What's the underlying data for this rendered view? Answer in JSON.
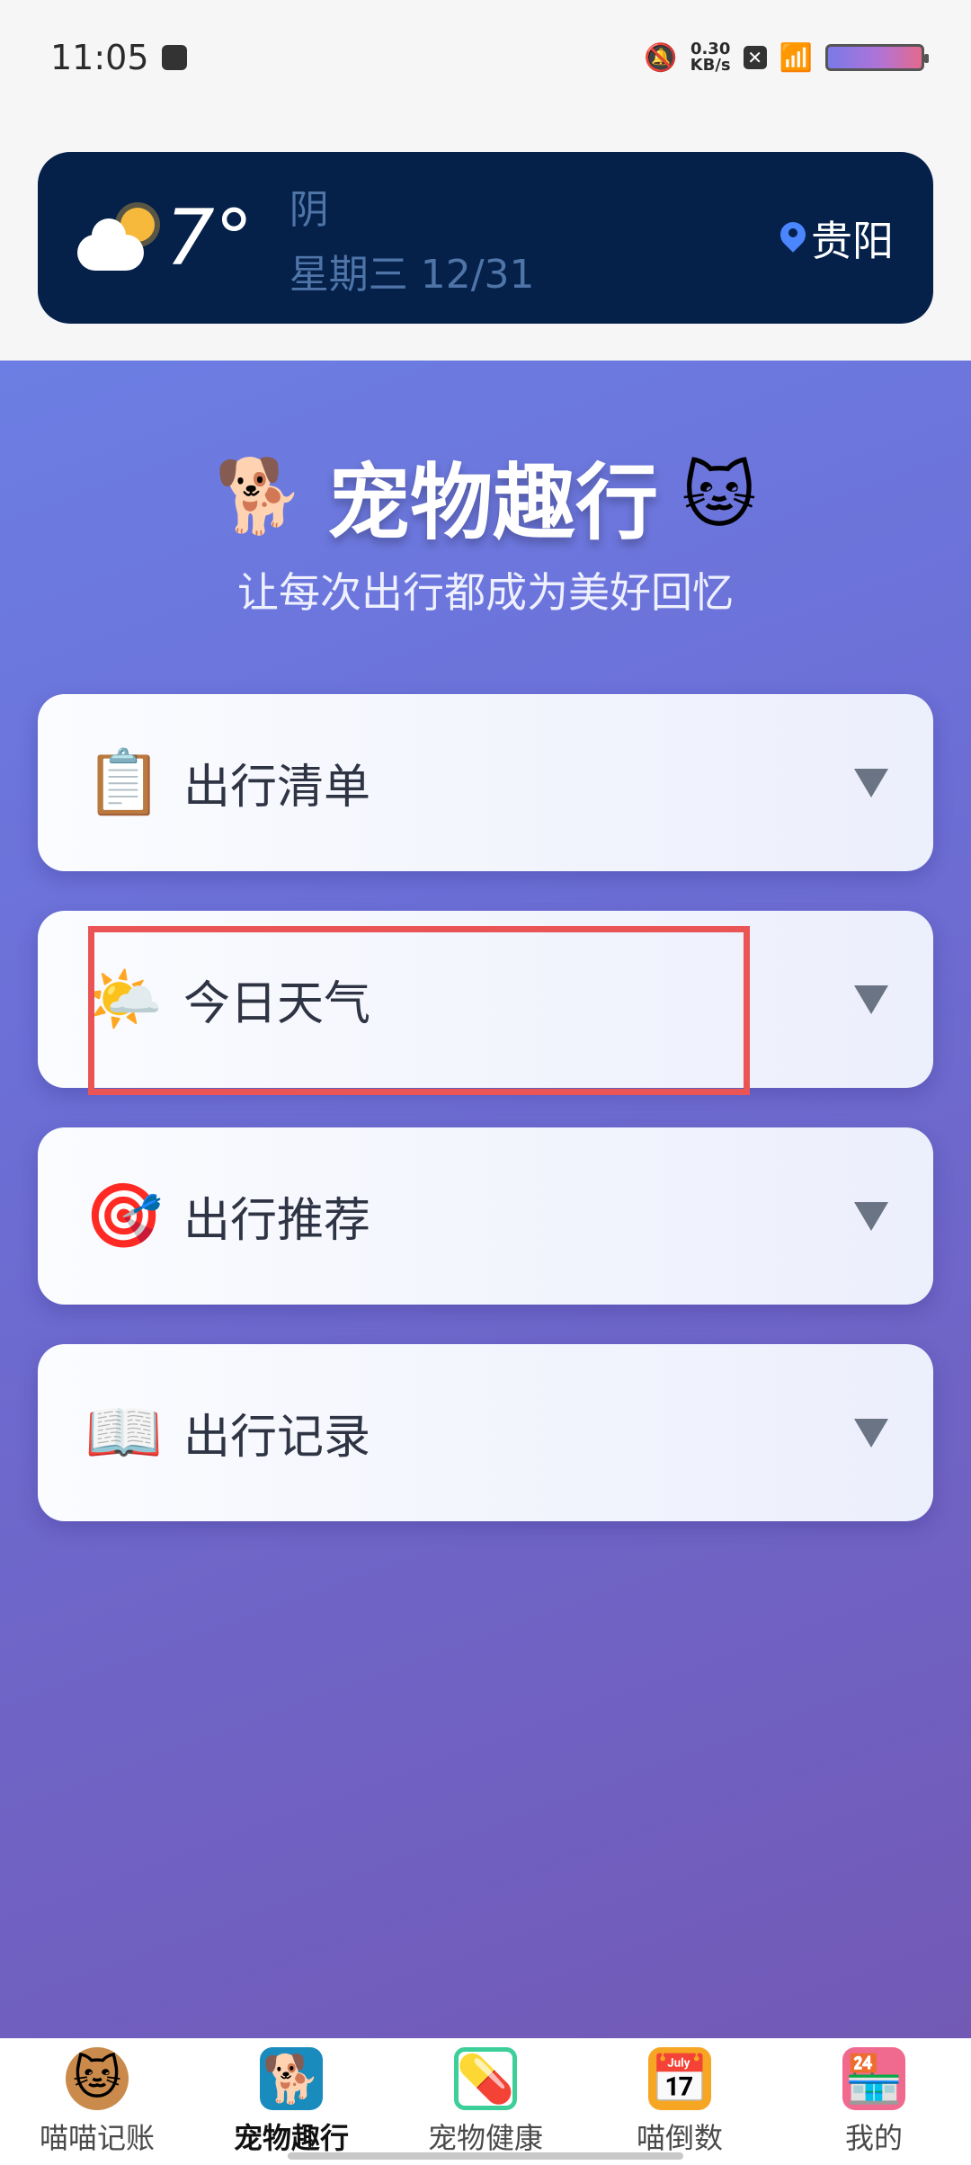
{
  "status_bar": {
    "time": "11:05",
    "net_speed_value": "0.30",
    "net_speed_unit": "KB/s",
    "icons": [
      "message-icon",
      "bell-muted-icon",
      "close-box-icon",
      "wifi-icon",
      "battery-icon"
    ]
  },
  "weather": {
    "temperature": "7°",
    "condition": "阴",
    "date": "星期三 12/31",
    "city": "贵阳",
    "icon": "cloud-sun-icon"
  },
  "header": {
    "title": "宠物趣行",
    "left_emoji": "🐕",
    "right_emoji": "🐱",
    "subtitle": "让每次出行都成为美好回忆"
  },
  "sections": [
    {
      "icon": "📋",
      "icon_name": "clipboard-icon",
      "label": "出行清单"
    },
    {
      "icon": "🌤️",
      "icon_name": "sun-cloud-icon",
      "label": "今日天气"
    },
    {
      "icon": "🎯",
      "icon_name": "target-icon",
      "label": "出行推荐"
    },
    {
      "icon": "📖",
      "icon_name": "book-icon",
      "label": "出行记录"
    }
  ],
  "bottom_nav": [
    {
      "label": "喵喵记账",
      "icon": "cat-face-icon",
      "glyph": "🐱"
    },
    {
      "label": "宠物趣行",
      "icon": "dog-walk-icon",
      "glyph": "🐕",
      "active": true
    },
    {
      "label": "宠物健康",
      "icon": "medicine-icon",
      "glyph": "💊"
    },
    {
      "label": "喵倒数",
      "icon": "calendar-icon",
      "glyph": "📅"
    },
    {
      "label": "我的",
      "icon": "shop-icon",
      "glyph": "🏪"
    }
  ],
  "colors": {
    "weather_card_bg": "#05214a",
    "panel_gradient_start": "#6c7ee3",
    "panel_gradient_end": "#7259b6",
    "highlight": "#ea5454"
  }
}
